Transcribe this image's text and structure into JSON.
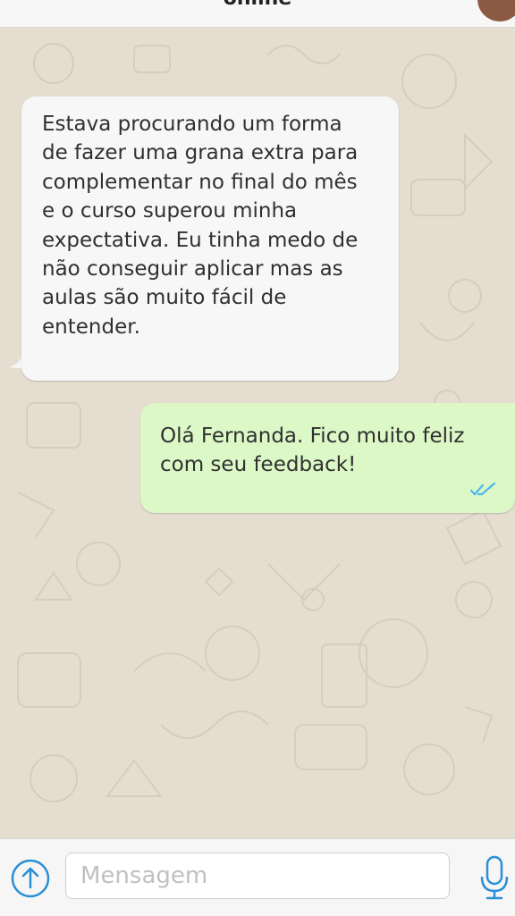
{
  "header": {
    "title": "online"
  },
  "messages": [
    {
      "direction": "incoming",
      "lines": [
        "Estava procurando um forma",
        "de fazer uma grana extra para",
        "complementar no final do mês",
        "e o curso superou minha",
        "expectativa. Eu tinha medo de",
        "não conseguir aplicar mas as",
        "aulas são muito fácil de",
        "entender."
      ]
    },
    {
      "direction": "outgoing",
      "lines": [
        "Olá Fernanda. Fico muito feliz",
        "com seu feedback!"
      ],
      "status_icon": "double-check-read-icon"
    }
  ],
  "composer": {
    "placeholder": "Mensagem",
    "left_icon": "upload-arrow-icon",
    "right_icon": "microphone-icon"
  },
  "colors": {
    "incoming_bubble": "#f7f7f7",
    "outgoing_bubble": "#dcf8c6",
    "accent_blue": "#2a8fd6",
    "read_ticks": "#4fb6ec"
  }
}
